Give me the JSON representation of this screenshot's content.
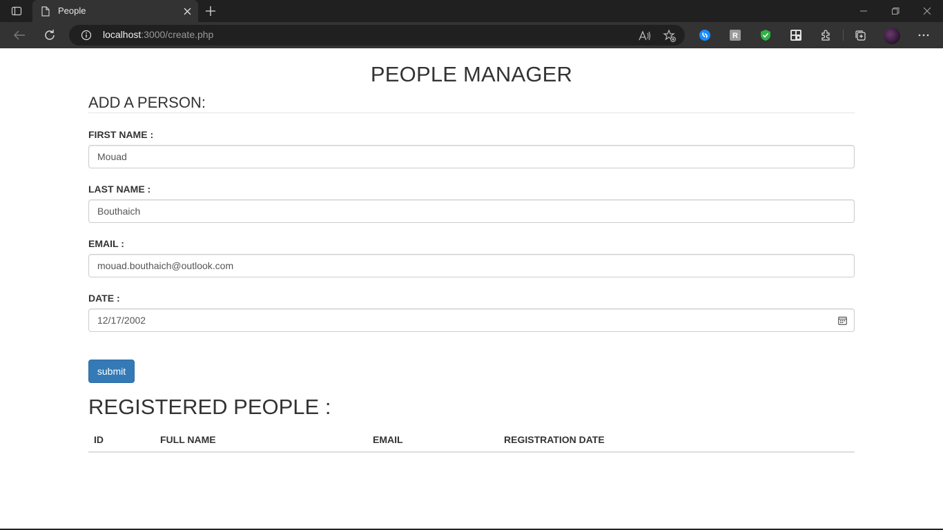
{
  "browser": {
    "tab_title": "People",
    "url_host": "localhost",
    "url_rest": ":3000/create.php"
  },
  "page": {
    "title": "PEOPLE MANAGER",
    "subtitle": "ADD A PERSON:",
    "form": {
      "first_name_label": "FIRST NAME :",
      "first_name_value": "Mouad",
      "last_name_label": "LAST NAME :",
      "last_name_value": "Bouthaich",
      "email_label": "EMAIL :",
      "email_value": "mouad.bouthaich@outlook.com",
      "date_label": "DATE :",
      "date_value": "12/17/2002",
      "submit_label": "submit"
    },
    "registered_title": "REGISTERED PEOPLE :",
    "table_headers": [
      "ID",
      "FULL NAME",
      "EMAIL",
      "REGISTRATION DATE"
    ]
  },
  "colors": {
    "primary_button": "#337ab7",
    "browser_chrome": "#333333"
  }
}
